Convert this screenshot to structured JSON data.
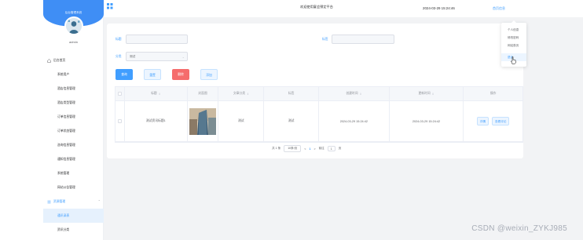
{
  "sidebar": {
    "brand_title": "后台管理系统",
    "username": "admin",
    "menu": [
      {
        "label": "后台首页",
        "type": "group",
        "icon": "home-icon"
      },
      {
        "label": "系统用户",
        "type": "sub"
      },
      {
        "label": "酒店信息管理",
        "type": "sub"
      },
      {
        "label": "酒店类型管理",
        "type": "sub"
      },
      {
        "label": "订单信息管理",
        "type": "sub"
      },
      {
        "label": "订单状态管理",
        "type": "sub"
      },
      {
        "label": "咨询信息管理",
        "type": "sub"
      },
      {
        "label": "通知信息管理",
        "type": "sub"
      },
      {
        "label": "系统管理",
        "type": "sub"
      },
      {
        "label": "网站公告管理",
        "type": "sub"
      },
      {
        "label": "资源管理",
        "type": "group",
        "icon": "list-icon",
        "active": true
      },
      {
        "label": "通讯录表",
        "type": "sub",
        "selected": true
      },
      {
        "label": "资讯分类",
        "type": "sub"
      }
    ]
  },
  "header": {
    "welcome": "欢迎使用宴会预定平台",
    "datetime": "2024-03-29 15:24:46",
    "home_link": "首页信息"
  },
  "dropdown": {
    "items": [
      "个人信息",
      "修改密码",
      "网站首页",
      "退出"
    ]
  },
  "search": {
    "label_title": "标题",
    "label_tag": "标签",
    "label_category": "分类",
    "category_value": "测试"
  },
  "toolbar": {
    "query": "查询",
    "reset": "重置",
    "delete": "删除",
    "add": "添加"
  },
  "table": {
    "columns": [
      "标题",
      "封面图",
      "文章分类",
      "标签",
      "创建时间",
      "更新时间",
      "操作"
    ],
    "rows": [
      {
        "title": "测试资讯标题1",
        "category": "测试",
        "tag": "测试",
        "created": "2024-03-29 15:24:42",
        "updated": "2024-03-29 15:24:42",
        "actions": [
          "详情",
          "查看评论"
        ]
      }
    ]
  },
  "pagination": {
    "total": "共 1 条",
    "page_size": "10条/页",
    "prev": "<",
    "current": "1",
    "next": ">",
    "goto_label": "前往",
    "goto_value": "1",
    "page_suffix": "页"
  },
  "watermark": "CSDN @weixin_ZYKJ985",
  "colors": {
    "primary": "#409eff",
    "danger": "#f56c6c",
    "brand": "#3f8ef5"
  }
}
